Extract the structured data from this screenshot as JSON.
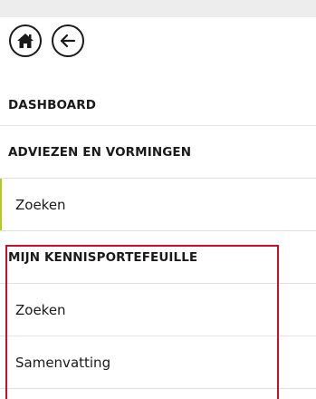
{
  "toolbar": {
    "home_icon": "home-icon",
    "back_icon": "arrow-left-icon"
  },
  "menu": {
    "items": [
      {
        "label": "DASHBOARD",
        "type": "heading"
      },
      {
        "label": "ADVIEZEN EN VORMINGEN",
        "type": "heading"
      },
      {
        "label": "Zoeken",
        "type": "sub",
        "active": true
      },
      {
        "label": "MIJN KENNISPORTEFEUILLE",
        "type": "heading"
      },
      {
        "label": "Zoeken",
        "type": "sub"
      },
      {
        "label": "Samenvatting",
        "type": "sub"
      }
    ]
  },
  "colors": {
    "accent_bar": "#b5c634",
    "highlight_border": "#c8102e"
  }
}
